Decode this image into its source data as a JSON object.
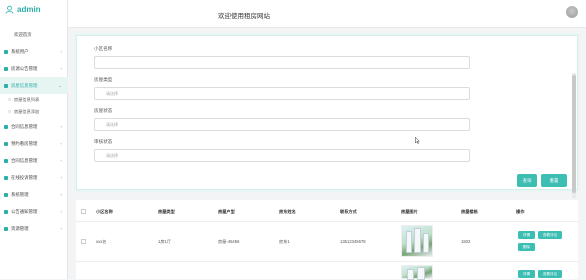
{
  "brand": {
    "name": "admin",
    "icon": "user-outline-icon"
  },
  "site": {
    "title": "欢迎使用租房网站"
  },
  "sidebar": {
    "home": "欢迎首页",
    "items": [
      {
        "label": "系统用户",
        "icon": "menu-icon"
      },
      {
        "label": "房源公告管理",
        "icon": "menu-icon"
      },
      {
        "label": "房屋信息管理",
        "icon": "menu-icon",
        "active": true
      },
      {
        "label": "合同信息管理",
        "icon": "menu-icon"
      },
      {
        "label": "预约看房管理",
        "icon": "menu-icon"
      },
      {
        "label": "合同信息管理",
        "icon": "menu-icon"
      },
      {
        "label": "在线投诉管理",
        "icon": "menu-icon"
      },
      {
        "label": "系统管理",
        "icon": "menu-icon"
      },
      {
        "label": "公告通知管理",
        "icon": "menu-icon"
      },
      {
        "label": "资源管理",
        "icon": "menu-icon"
      }
    ],
    "subitems": [
      {
        "label": "房屋信息列表"
      },
      {
        "label": "房屋信息添加"
      }
    ]
  },
  "search": {
    "fields": [
      {
        "label": "小区名称",
        "placeholder": ""
      },
      {
        "label": "房屋类型",
        "placeholder": "请选择"
      },
      {
        "label": "房屋状态",
        "placeholder": "请选择"
      },
      {
        "label": "审核状态",
        "placeholder": "请选择"
      }
    ],
    "query_label": "查询",
    "reset_label": "重置"
  },
  "table": {
    "columns": [
      "小区名称",
      "房屋类型",
      "房屋户型",
      "房东姓名",
      "联系方式",
      "房屋图片",
      "房屋楼栋",
      "操作"
    ],
    "rows": [
      {
        "name": "xxx名",
        "type": "1房1厅",
        "layout": "房屋-45456",
        "owner": "房东1",
        "phone": "13512345678",
        "building": "1502",
        "actions": [
          "详情",
          "查看评论",
          "删除"
        ]
      },
      {
        "actions": [
          "详情",
          "查看评论"
        ]
      }
    ]
  },
  "colors": {
    "accent": "#3dbeb3",
    "sidebar_active_bg": "#e6f4f2"
  }
}
